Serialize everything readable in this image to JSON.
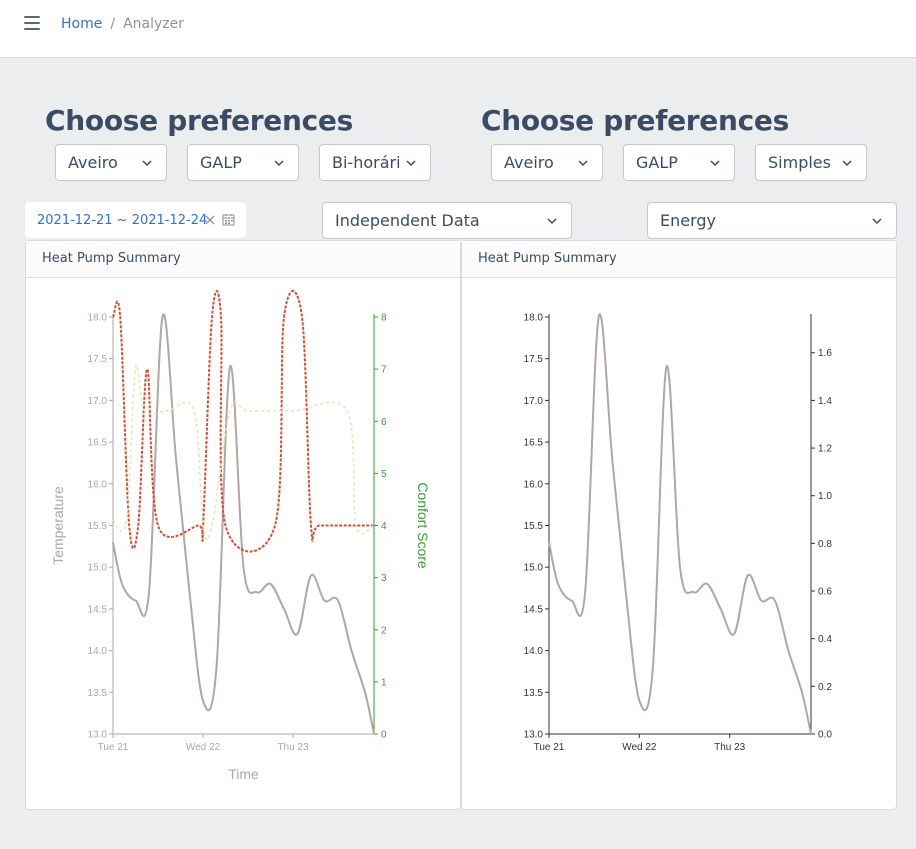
{
  "breadcrumb": {
    "home": "Home",
    "separator": "/",
    "current": "Analyzer"
  },
  "icons": {
    "menu": "hamburger-icon",
    "dropdown": "chevron-down-icon",
    "clear": "close-icon",
    "calendar": "calendar-icon"
  },
  "left_panel": {
    "title": "Choose preferences",
    "location": "Aveiro",
    "supplier": "GALP",
    "tariff": "Bi-horári",
    "date_range": "2021-12-21 ~ 2021-12-24",
    "card_title": "Heat Pump Summary"
  },
  "right_panel": {
    "title": "Choose preferences",
    "location": "Aveiro",
    "supplier": "GALP",
    "tariff": "Simples",
    "card_title": "Heat Pump Summary"
  },
  "data_type_select": "Independent Data",
  "metric_select": "Energy",
  "chart_data": [
    {
      "type": "line",
      "xlabel": "Time",
      "ylabel": "Temperature",
      "y2label": "Confort Score",
      "x_ticks": [
        "Tue 21",
        "Wed 22",
        "Thu 23"
      ],
      "ylim": [
        13.0,
        18.0
      ],
      "y_ticks": [
        "13.0",
        "13.5",
        "14.0",
        "14.5",
        "15.0",
        "15.5",
        "16.0",
        "16.5",
        "17.0",
        "17.5",
        "18.0"
      ],
      "y2lim": [
        0,
        8
      ],
      "y2_ticks": [
        "0",
        "1",
        "2",
        "3",
        "4",
        "5",
        "6",
        "7",
        "8"
      ],
      "colors": {
        "temperature": "#b0a6a4",
        "setpoint": "#d0503a",
        "comfort": "#e6e4b0",
        "y2_axis": "#3a9a3a",
        "y_axis": "#b0a6a4"
      },
      "series": [
        {
          "axis": "y",
          "style": "temperature",
          "x": [
            0,
            0.1,
            0.25,
            0.4,
            0.55,
            0.7,
            0.85,
            1.0,
            1.15,
            1.3,
            1.45,
            1.6,
            1.75,
            1.9,
            2.05,
            2.2,
            2.35,
            2.5,
            2.65,
            2.8,
            2.9
          ],
          "values": [
            15.3,
            14.8,
            14.6,
            14.7,
            18.0,
            16.3,
            14.7,
            13.4,
            13.8,
            17.4,
            15.0,
            14.7,
            14.8,
            14.5,
            14.2,
            14.9,
            14.6,
            14.6,
            14.0,
            13.5,
            13.0
          ]
        },
        {
          "axis": "y2",
          "style": "setpoint",
          "x": [
            0,
            0.08,
            0.18,
            0.28,
            0.38,
            0.5,
            0.95,
            1.0,
            1.1,
            1.2,
            1.25,
            1.8,
            1.9,
            2.1,
            2.2,
            2.3,
            2.9
          ],
          "values": [
            8,
            8,
            4,
            4,
            7,
            4,
            4,
            4,
            8,
            8,
            4,
            4,
            8,
            8,
            4,
            4,
            4
          ]
        },
        {
          "axis": "y2",
          "style": "comfort",
          "x": [
            0,
            0.15,
            0.25,
            0.35,
            0.6,
            0.9,
            1.0,
            1.1,
            1.3,
            1.5,
            2.0,
            2.6,
            2.7,
            2.9
          ],
          "values": [
            4.1,
            4.1,
            7,
            6.2,
            6.2,
            6.2,
            4,
            4,
            6.2,
            6.2,
            6.2,
            6.2,
            4,
            4
          ]
        }
      ]
    },
    {
      "type": "line",
      "x_ticks": [
        "Tue 21",
        "Wed 22",
        "Thu 23"
      ],
      "ylim": [
        13.0,
        18.0
      ],
      "y_ticks": [
        "13.0",
        "13.5",
        "14.0",
        "14.5",
        "15.0",
        "15.5",
        "16.0",
        "16.5",
        "17.0",
        "17.5",
        "18.0"
      ],
      "y2lim": [
        0,
        1.75
      ],
      "y2_ticks": [
        "0.0",
        "0.2",
        "0.4",
        "0.6",
        "0.8",
        "1.0",
        "1.2",
        "1.4",
        "1.6"
      ],
      "colors": {
        "temperature": "#b0a6a4",
        "axis": "#333333"
      },
      "series": [
        {
          "axis": "y",
          "style": "temperature",
          "x": [
            0,
            0.1,
            0.25,
            0.4,
            0.55,
            0.7,
            0.85,
            1.0,
            1.15,
            1.3,
            1.45,
            1.6,
            1.75,
            1.9,
            2.05,
            2.2,
            2.35,
            2.5,
            2.65,
            2.8,
            2.9
          ],
          "values": [
            15.3,
            14.8,
            14.6,
            14.7,
            18.0,
            16.3,
            14.7,
            13.4,
            13.8,
            17.4,
            15.0,
            14.7,
            14.8,
            14.5,
            14.2,
            14.9,
            14.6,
            14.6,
            14.0,
            13.5,
            13.0
          ]
        }
      ]
    }
  ]
}
